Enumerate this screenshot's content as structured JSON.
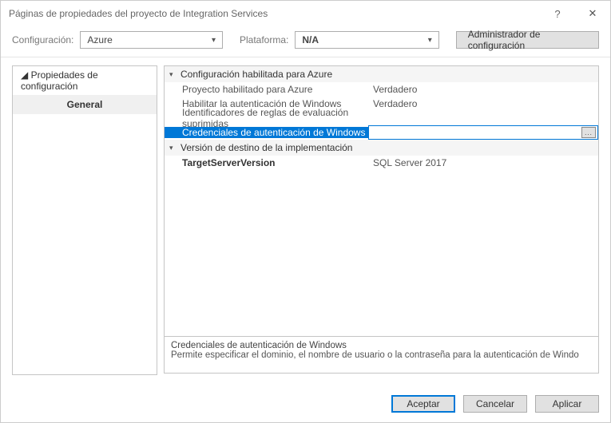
{
  "window": {
    "title": "Páginas de propiedades del proyecto de Integration Services",
    "help": "?",
    "close": "✕"
  },
  "config_bar": {
    "config_label": "Configuración:",
    "config_value": "Azure",
    "platform_label": "Plataforma:",
    "platform_value": "N/A",
    "manager_button": "Administrador de configuración"
  },
  "sidebar": {
    "root": "◢ Propiedades de configuración",
    "items": [
      {
        "label": "General"
      }
    ]
  },
  "property_grid": {
    "categories": [
      {
        "name": "Configuración habilitada para Azure",
        "props": [
          {
            "label": "Proyecto habilitado para Azure",
            "value": "Verdadero"
          },
          {
            "label": "Habilitar la autenticación de Windows",
            "value": "Verdadero"
          },
          {
            "label": "Identificadores de reglas de evaluación suprimidas",
            "value": ""
          },
          {
            "label": "Credenciales de autenticación de Windows",
            "value": "",
            "selected": true,
            "ellipsis": true
          }
        ]
      },
      {
        "name": "Versión de destino de la implementación",
        "props": [
          {
            "label": "TargetServerVersion",
            "value": "SQL Server 2017",
            "bold": true
          }
        ]
      }
    ]
  },
  "description": {
    "title": "Credenciales de autenticación de Windows",
    "text": "Permite especificar el dominio, el nombre de usuario o la contraseña para la autenticación de Windo"
  },
  "buttons": {
    "ok": "Aceptar",
    "cancel": "Cancelar",
    "apply": "Aplicar"
  },
  "icons": {
    "ellipsis": "..."
  }
}
